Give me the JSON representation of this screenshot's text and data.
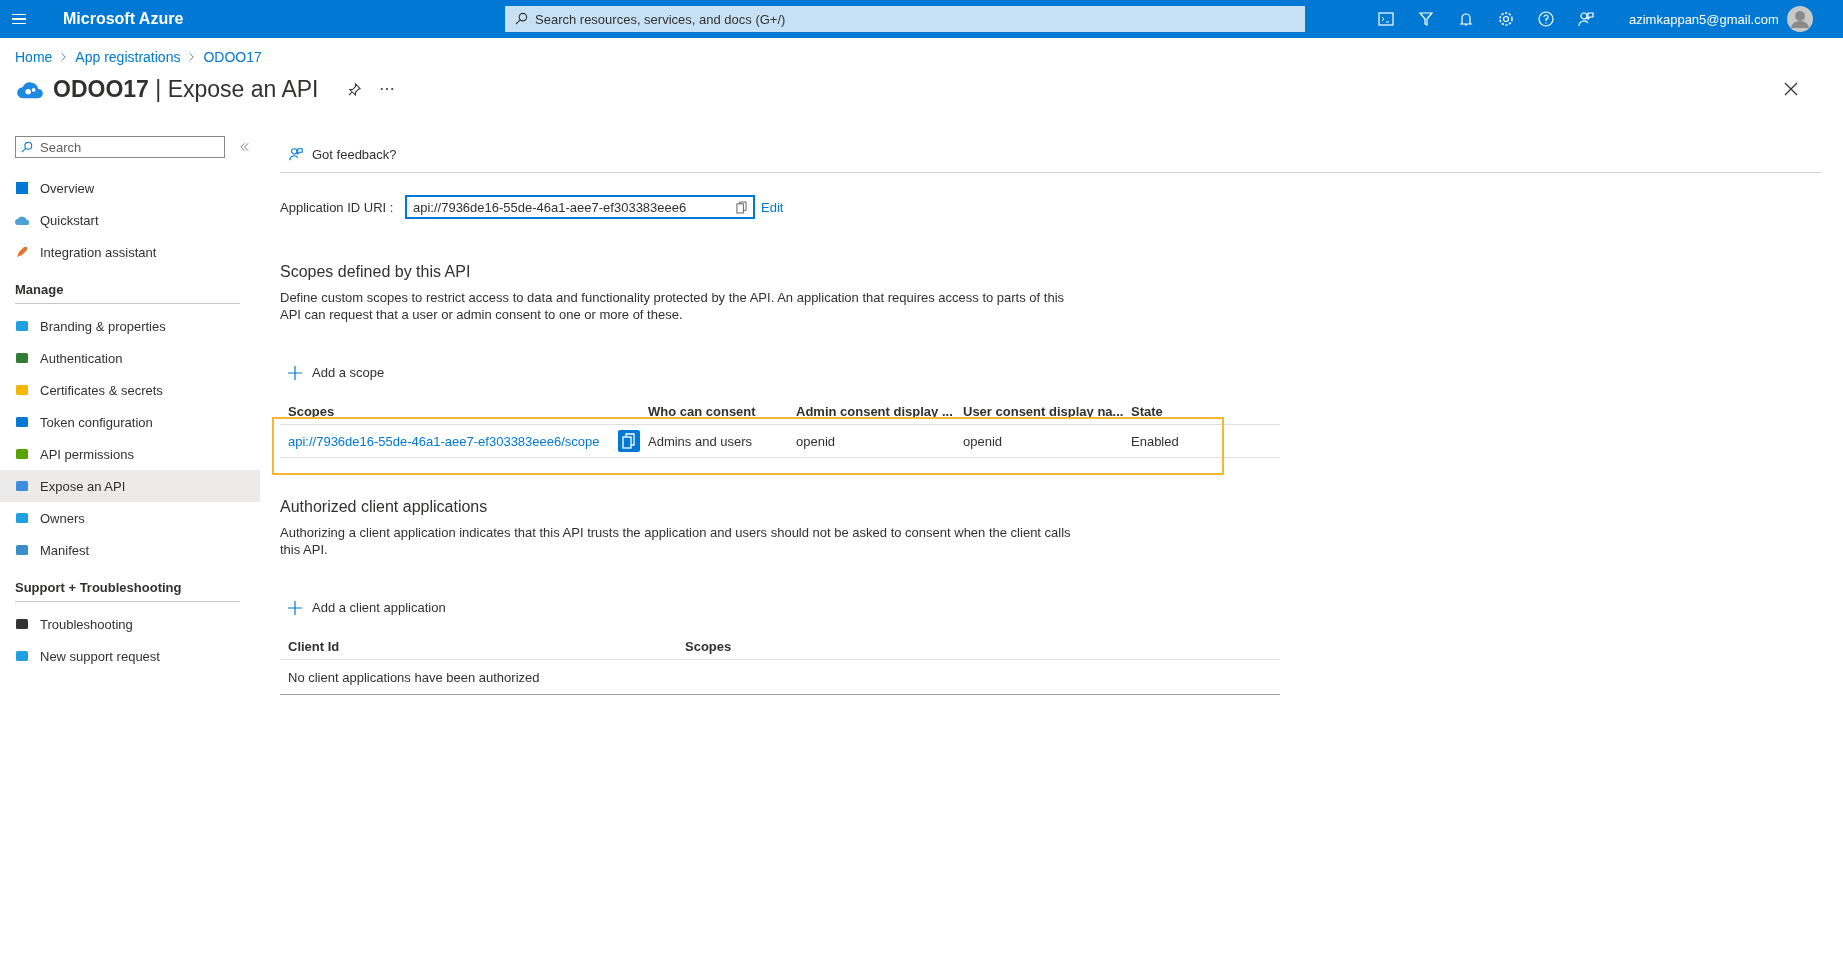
{
  "top_bar": {
    "brand": "Microsoft Azure",
    "search_placeholder": "Search resources, services, and docs (G+/)",
    "account": "azimkappan5@gmail.com"
  },
  "breadcrumb": [
    "Home",
    "App registrations",
    "ODOO17"
  ],
  "page_title": {
    "resource": "ODOO17",
    "separator": "|",
    "blade": "Expose an API"
  },
  "sidebar": {
    "search_placeholder": "Search",
    "items": [
      {
        "label": "Overview",
        "selected": false
      },
      {
        "label": "Quickstart",
        "selected": false
      },
      {
        "label": "Integration assistant",
        "selected": false
      }
    ],
    "sections": [
      {
        "title": "Manage",
        "items": [
          {
            "label": "Branding & properties",
            "selected": false
          },
          {
            "label": "Authentication",
            "selected": false
          },
          {
            "label": "Certificates & secrets",
            "selected": false
          },
          {
            "label": "Token configuration",
            "selected": false
          },
          {
            "label": "API permissions",
            "selected": false
          },
          {
            "label": "Expose an API",
            "selected": true
          },
          {
            "label": "Owners",
            "selected": false
          },
          {
            "label": "Manifest",
            "selected": false
          }
        ]
      },
      {
        "title": "Support + Troubleshooting",
        "items": [
          {
            "label": "Troubleshooting",
            "selected": false
          },
          {
            "label": "New support request",
            "selected": false
          }
        ]
      }
    ]
  },
  "toolbar": {
    "feedback": "Got feedback?"
  },
  "app_id_uri": {
    "label": "Application ID URI :",
    "value": "api://7936de16-55de-46a1-aee7-ef303383eee6",
    "edit": "Edit"
  },
  "scopes_section": {
    "title": "Scopes defined by this API",
    "description": "Define custom scopes to restrict access to data and functionality protected by the API. An application that requires access to parts of this API can request that a user or admin consent to one or more of these.",
    "add": "Add a scope",
    "columns": [
      "Scopes",
      "Who can consent",
      "Admin consent display ...",
      "User consent display na...",
      "State"
    ],
    "rows": [
      {
        "scope": "api://7936de16-55de-46a1-aee7-ef303383eee6/scope",
        "who": "Admins and users",
        "admin": "openid",
        "user": "openid",
        "state": "Enabled",
        "highlighted": true
      }
    ]
  },
  "clients_section": {
    "title": "Authorized client applications",
    "description": "Authorizing a client application indicates that this API trusts the application and users should not be asked to consent when the client calls this API.",
    "add": "Add a client application",
    "columns": [
      "Client Id",
      "Scopes"
    ],
    "empty_message": "No client applications have been authorized"
  }
}
